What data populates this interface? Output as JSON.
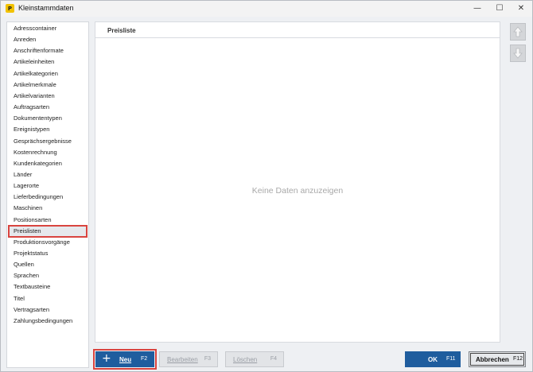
{
  "window": {
    "title": "Kleinstammdaten",
    "app_icon_glyph": "P",
    "minimize_glyph": "—",
    "maximize_glyph": "☐",
    "close_glyph": "✕"
  },
  "sidebar": {
    "items": [
      {
        "label": "Adresscontainer"
      },
      {
        "label": "Anreden"
      },
      {
        "label": "Anschriftenformate"
      },
      {
        "label": "Artikeleinheiten"
      },
      {
        "label": "Artikelkategorien"
      },
      {
        "label": "Artikelmerkmale"
      },
      {
        "label": "Artikelvarianten"
      },
      {
        "label": "Auftragsarten"
      },
      {
        "label": "Dokumententypen"
      },
      {
        "label": "Ereignistypen"
      },
      {
        "label": "Gesprächsergebnisse"
      },
      {
        "label": "Kostenrechnung"
      },
      {
        "label": "Kundenkategorien"
      },
      {
        "label": "Länder"
      },
      {
        "label": "Lagerorte"
      },
      {
        "label": "Lieferbedingungen"
      },
      {
        "label": "Maschinen"
      },
      {
        "label": "Positionsarten"
      },
      {
        "label": "Preislisten",
        "selected": true
      },
      {
        "label": "Produktionsvorgänge"
      },
      {
        "label": "Projektstatus"
      },
      {
        "label": "Quellen"
      },
      {
        "label": "Sprachen"
      },
      {
        "label": "Textbausteine"
      },
      {
        "label": "Titel"
      },
      {
        "label": "Vertragsarten"
      },
      {
        "label": "Zahlungsbedingungen"
      }
    ]
  },
  "main": {
    "column_header": "Preisliste",
    "empty_message": "Keine Daten anzuzeigen"
  },
  "side_controls": {
    "up_icon": "arrow-up-icon",
    "down_icon": "arrow-down-icon"
  },
  "buttons": {
    "new": {
      "label": "Neu",
      "shortcut": "F2",
      "icon": "+"
    },
    "edit": {
      "label": "Bearbeiten",
      "shortcut": "F3"
    },
    "delete": {
      "label": "Löschen",
      "shortcut": "F4"
    },
    "ok": {
      "label": "OK",
      "shortcut": "F11"
    },
    "cancel": {
      "label": "Abbrechen",
      "shortcut": "F12"
    }
  },
  "colors": {
    "primary_button": "#1f5d9e",
    "highlight_outline": "#d9443f",
    "app_icon": "#f2c200"
  }
}
